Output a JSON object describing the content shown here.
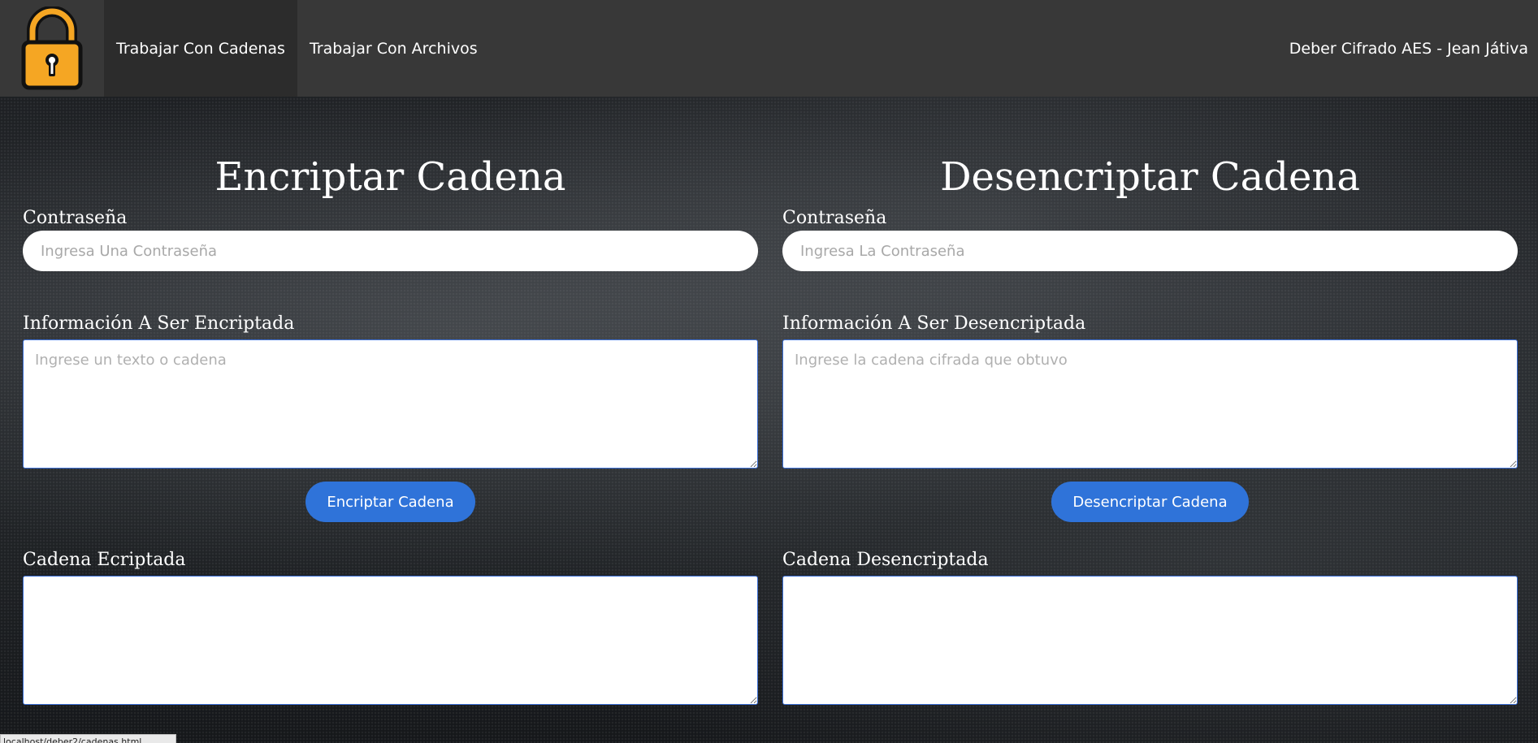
{
  "nav": {
    "logo_icon": "padlock-icon",
    "links": [
      {
        "label": "Trabajar Con Cadenas",
        "active": true
      },
      {
        "label": "Trabajar Con Archivos",
        "active": false
      }
    ],
    "right_text": "Deber Cifrado AES - Jean Játiva"
  },
  "encrypt": {
    "title": "Encriptar Cadena",
    "password_label": "Contraseña",
    "password_placeholder": "Ingresa Una Contraseña",
    "info_label": "Información A Ser Encriptada",
    "info_placeholder": "Ingrese un texto o cadena",
    "button_label": "Encriptar Cadena",
    "result_label": "Cadena Ecriptada",
    "result_value": ""
  },
  "decrypt": {
    "title": "Desencriptar Cadena",
    "password_label": "Contraseña",
    "password_placeholder": "Ingresa La Contraseña",
    "info_label": "Información A Ser Desencriptada",
    "info_placeholder": "Ingrese la cadena cifrada que obtuvo",
    "button_label": "Desencriptar Cadena",
    "result_label": "Cadena Desencriptada",
    "result_value": ""
  },
  "status_bar": {
    "url": "localhost/deber2/cadenas.html"
  },
  "colors": {
    "navbar": "#383838",
    "nav_active": "#2c2c2c",
    "button": "#2f73d9",
    "textarea_border": "#3b6fd6",
    "lock_body": "#f5a623"
  }
}
